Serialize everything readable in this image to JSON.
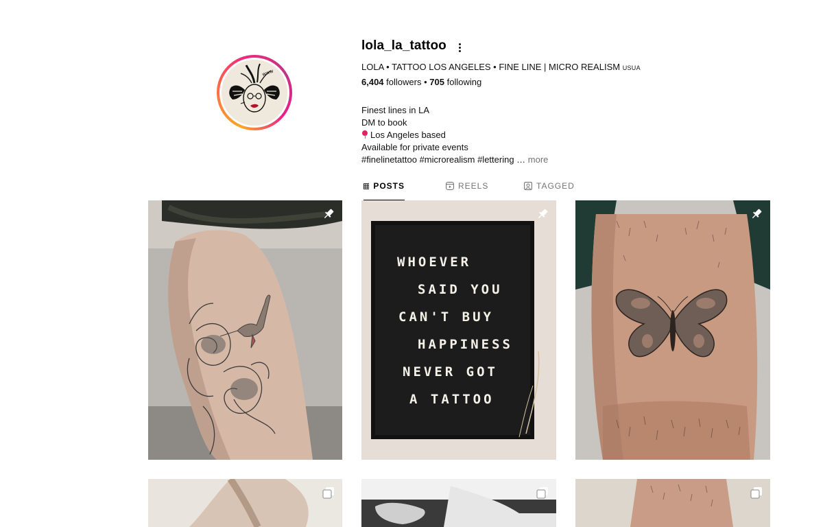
{
  "profile": {
    "username": "lola_la_tattoo",
    "full_name": "LOLA • TATTOO LOS ANGELES • FINE LINE | MICRO REALISM",
    "full_name_tag": "USUA",
    "followers_count": "6,404",
    "followers_label": "followers",
    "separator": "•",
    "following_count": "705",
    "following_label": "following",
    "bio_lines": [
      "Finest lines in LA",
      "DM to book",
      "Los Angeles based",
      "Available for private events",
      "#finelinetattoo #microrealism #lettering …"
    ],
    "bio_more": "more"
  },
  "tabs": [
    {
      "label": "POSTS",
      "icon": "grid-icon",
      "active": true
    },
    {
      "label": "REELS",
      "icon": "reels-icon",
      "active": false
    },
    {
      "label": "TAGGED",
      "icon": "tagged-icon",
      "active": false
    }
  ],
  "posts": [
    {
      "subject": "hummingbird and flower tattoo on calf",
      "badge": "pin-icon"
    },
    {
      "subject": "letter board",
      "badge": "pin-icon",
      "board_lines": [
        "WHOEVER",
        "SAID YOU",
        "CAN'T BUY",
        "HAPPINESS",
        "NEVER GOT",
        "A TATTOO"
      ]
    },
    {
      "subject": "butterfly tattoo on thigh",
      "badge": "pin-icon"
    },
    {
      "subject": "tattoo photo",
      "badge": "carousel-icon"
    },
    {
      "subject": "tattoo photo",
      "badge": "carousel-icon"
    },
    {
      "subject": "tattoo photo",
      "badge": "carousel-icon"
    }
  ],
  "colors": {
    "accent_ring_start": "#f9a825",
    "accent_ring_end": "#c13584",
    "muted_text": "#737373",
    "pin_marker": "#e91e63"
  }
}
